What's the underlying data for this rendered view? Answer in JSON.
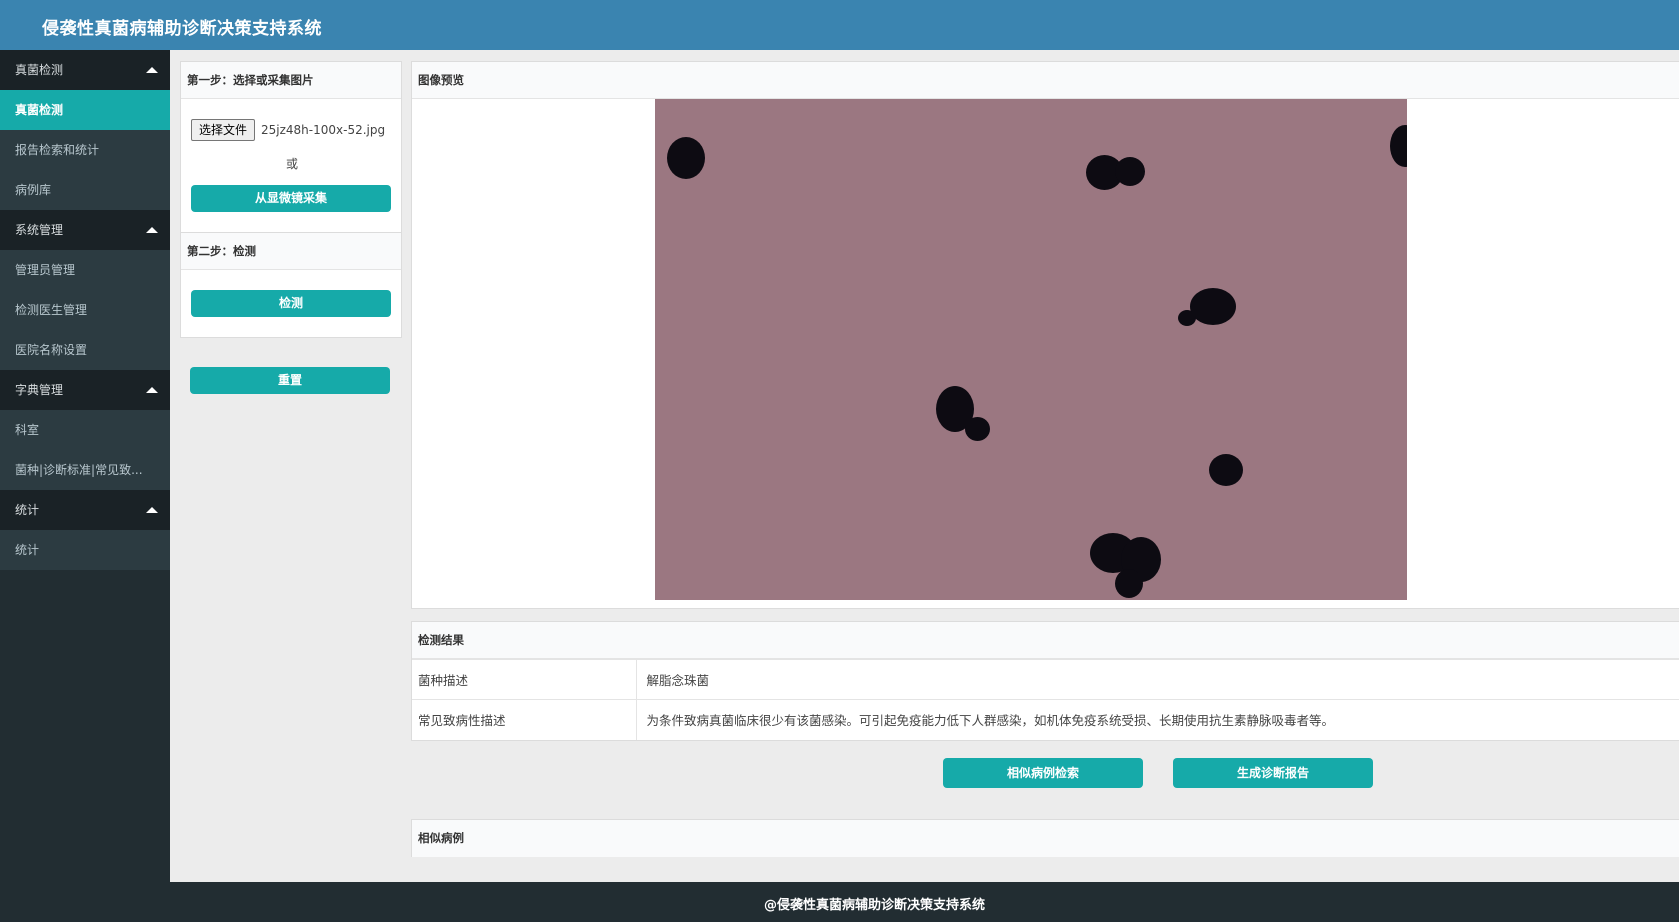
{
  "header": {
    "title": "侵袭性真菌病辅助诊断决策支持系统"
  },
  "sidebar": {
    "groups": [
      {
        "label": "真菌检测",
        "items": [
          {
            "label": "真菌检测"
          },
          {
            "label": "报告检索和统计"
          },
          {
            "label": "病例库"
          }
        ]
      },
      {
        "label": "系统管理",
        "items": [
          {
            "label": "管理员管理"
          },
          {
            "label": "检测医生管理"
          },
          {
            "label": "医院名称设置"
          }
        ]
      },
      {
        "label": "字典管理",
        "items": [
          {
            "label": "科室"
          },
          {
            "label": "菌种|诊断标准|常见致..."
          }
        ]
      },
      {
        "label": "统计",
        "items": [
          {
            "label": "统计"
          }
        ]
      }
    ]
  },
  "step1": {
    "title": "第一步：选择或采集图片",
    "file_button": "选择文件",
    "file_name": "25jz48h-100x-52.jpg",
    "or": "或",
    "capture_button": "从显微镜采集"
  },
  "step2": {
    "title": "第二步：检测",
    "detect_button": "检测"
  },
  "reset_button": "重置",
  "preview": {
    "title": "图像预览"
  },
  "result": {
    "title": "检测结果",
    "rows": [
      {
        "key": "菌种描述",
        "value": "解脂念珠菌"
      },
      {
        "key": "常见致病性描述",
        "value": "为条件致病真菌临床很少有该菌感染。可引起免疫能力低下人群感染，如机体免疫系统受损、长期使用抗生素静脉吸毒者等。"
      }
    ]
  },
  "actions": {
    "similar_search": "相似病例检索",
    "generate_report": "生成诊断报告"
  },
  "similar": {
    "title": "相似病例"
  },
  "footer": {
    "text": "@侵袭性真菌病辅助诊断决策支持系统"
  },
  "colors": {
    "header": "#3a84b0",
    "accent": "#16aaa9",
    "sidebar": "#222d32"
  }
}
